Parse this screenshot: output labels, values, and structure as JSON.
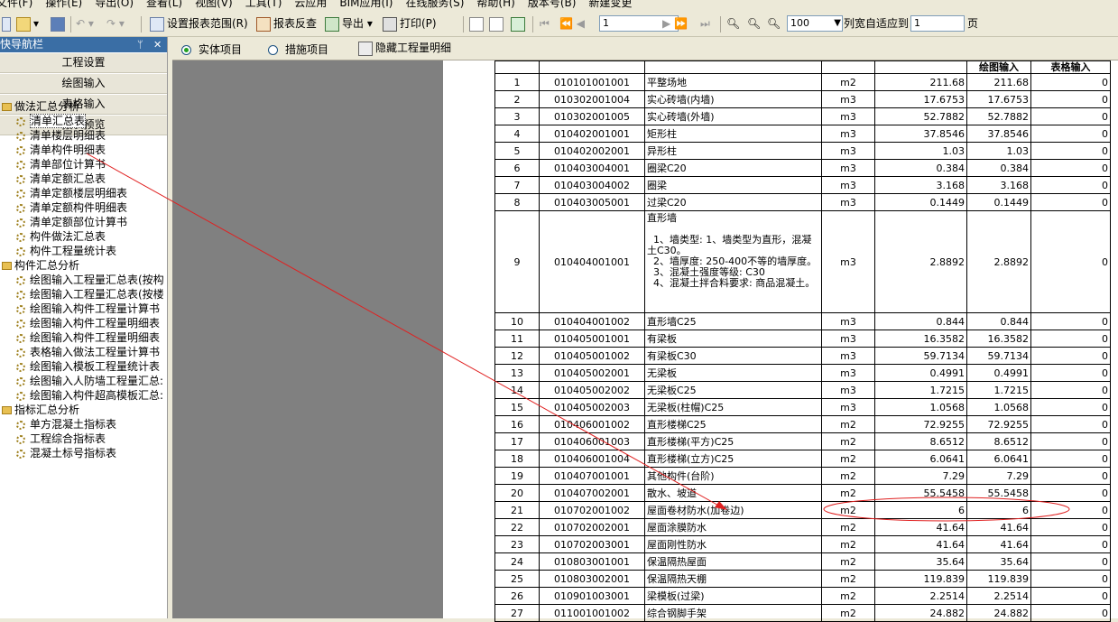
{
  "menubar": [
    "文件(F)",
    "操作(E)",
    "导出(O)",
    "查看(L)",
    "视图(V)",
    "工具(T)",
    "云应用",
    "BIM应用(I)",
    "在线服务(S)",
    "帮助(H)",
    "版本号(B)",
    "新建变更"
  ],
  "toolbar": {
    "set_range": "设置报表范围(R)",
    "report_check": "报表反查",
    "export": "导出",
    "print": "打印(P)",
    "page_value": "1",
    "zoom_value": "100",
    "fit_label": "列宽自适应到",
    "fit_value": "1",
    "page_unit": "页"
  },
  "sidebar": {
    "title": "快导航栏",
    "pin": "ᛘ",
    "close": "✕",
    "buttons": [
      "工程设置",
      "绘图输入",
      "表格输入",
      "报表预览"
    ],
    "groups": [
      {
        "label": "做法汇总分析",
        "items": [
          "清单汇总表",
          "清单楼层明细表",
          "清单构件明细表",
          "清单部位计算书",
          "清单定额汇总表",
          "清单定额楼层明细表",
          "清单定额构件明细表",
          "清单定额部位计算书",
          "构件做法汇总表",
          "构件工程量统计表"
        ]
      },
      {
        "label": "构件汇总分析",
        "items": [
          "绘图输入工程量汇总表(按构",
          "绘图输入工程量汇总表(按楼",
          "绘图输入构件工程量计算书",
          "绘图输入构件工程量明细表",
          "绘图输入构件工程量明细表",
          "表格输入做法工程量计算书",
          "绘图输入模板工程量统计表",
          "绘图输入人防墙工程量汇总:",
          "绘图输入构件超高模板汇总:"
        ]
      },
      {
        "label": "指标汇总分析",
        "items": [
          "单方混凝土指标表",
          "工程综合指标表",
          "混凝土标号指标表"
        ]
      }
    ]
  },
  "tabs": {
    "entity": "实体项目",
    "measure": "措施项目",
    "hide": "隐藏工程量明细"
  },
  "table": {
    "headers": [
      "",
      "",
      "",
      "",
      "",
      "绘图输入",
      "表格输入"
    ],
    "rows": [
      [
        "1",
        "010101001001",
        "平整场地",
        "m2",
        "211.68",
        "211.68",
        "0"
      ],
      [
        "2",
        "010302001004",
        "实心砖墙(内墙)",
        "m3",
        "17.6753",
        "17.6753",
        "0"
      ],
      [
        "3",
        "010302001005",
        "实心砖墙(外墙)",
        "m3",
        "52.7882",
        "52.7882",
        "0"
      ],
      [
        "4",
        "010402001001",
        "矩形柱",
        "m3",
        "37.8546",
        "37.8546",
        "0"
      ],
      [
        "5",
        "010402002001",
        "异形柱",
        "m3",
        "1.03",
        "1.03",
        "0"
      ],
      [
        "6",
        "010403004001",
        "圈梁C20",
        "m3",
        "0.384",
        "0.384",
        "0"
      ],
      [
        "7",
        "010403004002",
        "圈梁",
        "m3",
        "3.168",
        "3.168",
        "0"
      ],
      [
        "8",
        "010403005001",
        "过梁C20",
        "m3",
        "0.1449",
        "0.1449",
        "0"
      ],
      [
        "9",
        "010404001001",
        "直形墙\n\n  1、墙类型: 1、墙类型为直形，混凝土C30。\n  2、墙厚度: 250-400不等的墙厚度。\n  3、混凝土强度等级: C30\n  4、混凝土拌合料要求: 商品混凝土。",
        "m3",
        "2.8892",
        "2.8892",
        "0"
      ],
      [
        "10",
        "010404001002",
        "直形墙C25",
        "m3",
        "0.844",
        "0.844",
        "0"
      ],
      [
        "11",
        "010405001001",
        "有梁板",
        "m3",
        "16.3582",
        "16.3582",
        "0"
      ],
      [
        "12",
        "010405001002",
        "有梁板C30",
        "m3",
        "59.7134",
        "59.7134",
        "0"
      ],
      [
        "13",
        "010405002001",
        "无梁板",
        "m3",
        "0.4991",
        "0.4991",
        "0"
      ],
      [
        "14",
        "010405002002",
        "无梁板C25",
        "m3",
        "1.7215",
        "1.7215",
        "0"
      ],
      [
        "15",
        "010405002003",
        "无梁板(柱帽)C25",
        "m3",
        "1.0568",
        "1.0568",
        "0"
      ],
      [
        "16",
        "010406001002",
        "直形楼梯C25",
        "m2",
        "72.9255",
        "72.9255",
        "0"
      ],
      [
        "17",
        "010406001003",
        "直形楼梯(平方)C25",
        "m2",
        "8.6512",
        "8.6512",
        "0"
      ],
      [
        "18",
        "010406001004",
        "直形楼梯(立方)C25",
        "m2",
        "6.0641",
        "6.0641",
        "0"
      ],
      [
        "19",
        "010407001001",
        "其他构件(台阶)",
        "m2",
        "7.29",
        "7.29",
        "0"
      ],
      [
        "20",
        "010407002001",
        "散水、坡道",
        "m2",
        "55.5458",
        "55.5458",
        "0"
      ],
      [
        "21",
        "010702001002",
        "屋面卷材防水(加卷边)",
        "m2",
        "6",
        "6",
        "0"
      ],
      [
        "22",
        "010702002001",
        "屋面涂膜防水",
        "m2",
        "41.64",
        "41.64",
        "0"
      ],
      [
        "23",
        "010702003001",
        "屋面刚性防水",
        "m2",
        "41.64",
        "41.64",
        "0"
      ],
      [
        "24",
        "010803001001",
        "保温隔热屋面",
        "m2",
        "35.64",
        "35.64",
        "0"
      ],
      [
        "25",
        "010803002001",
        "保温隔热天棚",
        "m2",
        "119.839",
        "119.839",
        "0"
      ],
      [
        "26",
        "010901003001",
        "梁模板(过梁)",
        "m2",
        "2.2514",
        "2.2514",
        "0"
      ],
      [
        "27",
        "011001001002",
        "综合钢脚手架",
        "m2",
        "24.882",
        "24.882",
        "0"
      ]
    ]
  },
  "colors": {
    "annotation": "#e02020",
    "sidebar_title": "#3a6ea5"
  }
}
